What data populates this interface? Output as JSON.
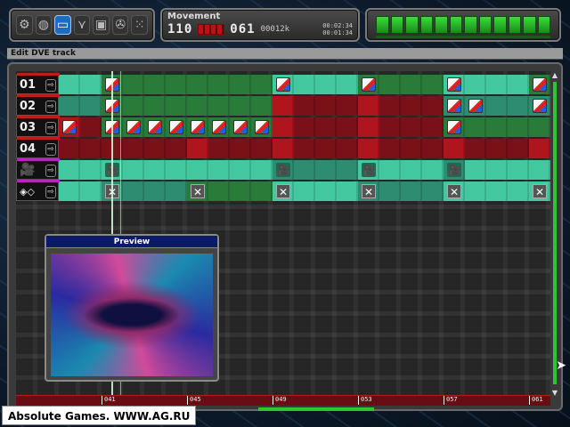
{
  "toolbar": {
    "icons": [
      "settings-icon",
      "globe-icon",
      "monitor-icon",
      "funnel-icon",
      "floppy-disk-icon",
      "film-reel-icon",
      "grid-icon"
    ],
    "active_index": 2
  },
  "movement": {
    "title": "Movement",
    "value_a": "110",
    "value_b": "061",
    "size": "00012k",
    "time_1": "00:02:34",
    "time_2": "00:01:34"
  },
  "section": {
    "title": "Edit DVE track"
  },
  "tracks": [
    {
      "label": "01"
    },
    {
      "label": "02"
    },
    {
      "label": "03"
    },
    {
      "label": "04"
    },
    {
      "label": "camera"
    },
    {
      "label": "transitions"
    }
  ],
  "preview": {
    "title": "Preview"
  },
  "ruler": {
    "ticks": [
      "041",
      "045",
      "049",
      "053",
      "057",
      "061"
    ]
  },
  "watermark": "Absolute Games. WWW.AG.RU",
  "colors": {
    "accent_green": "#2ac82a",
    "track_mint": "#44c8a0",
    "track_red": "#b0141c",
    "preview_title_bg": "#0c1a6a"
  }
}
